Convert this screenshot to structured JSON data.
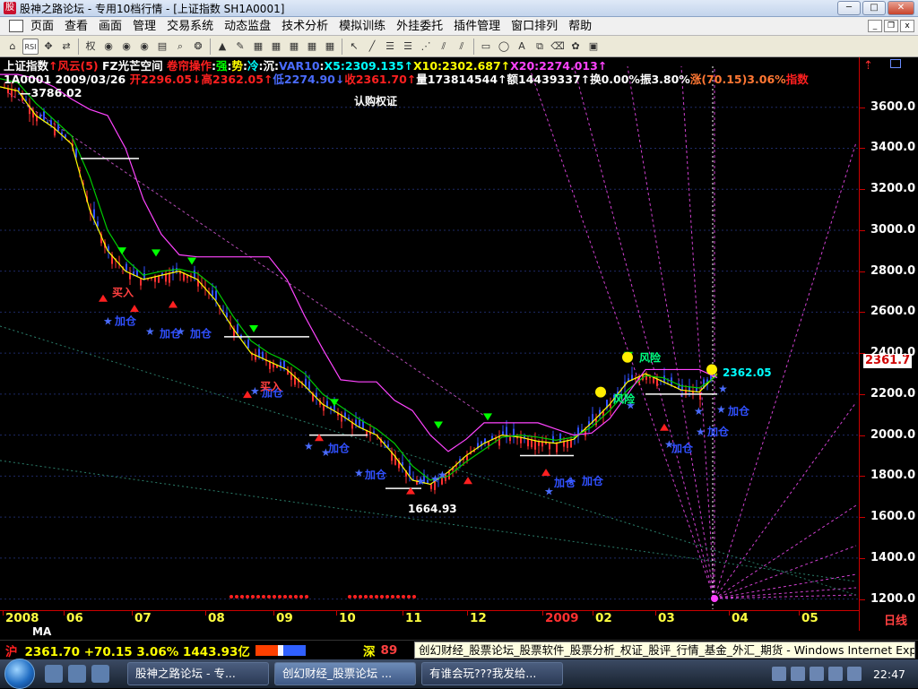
{
  "window": {
    "title": "股神之路论坛 - 专用10档行情 - [上证指数 SH1A0001]",
    "app_icon_glyph": "股",
    "buttons": [
      "minimize",
      "maximize",
      "close"
    ]
  },
  "menu": {
    "items": [
      "页面",
      "查看",
      "画面",
      "管理",
      "交易系统",
      "动态监盘",
      "技术分析",
      "模拟训练",
      "外挂委托",
      "插件管理",
      "窗口排列",
      "帮助"
    ]
  },
  "toolbar": {
    "icons": [
      "home-icon",
      "rsi-icon",
      "move-icon",
      "swap-icon",
      "weight-icon",
      "tool-icon",
      "tool-icon",
      "tool-icon",
      "book-icon",
      "search-icon",
      "indicator-icon",
      "alert-icon",
      "pen-icon",
      "grid-icon",
      "grid-icon",
      "grid-icon",
      "grid-icon",
      "grid-icon",
      "cursor-icon",
      "line-icon",
      "bars-icon",
      "bars-icon",
      "fan-icon",
      "fork-icon",
      "fork-icon",
      "rect-icon",
      "ellipse-icon",
      "text-icon",
      "copy-icon",
      "eraser-icon",
      "palette-icon",
      "save-icon"
    ],
    "labels": {
      "rsi": "RSI",
      "weight": "权"
    }
  },
  "header": {
    "line1": [
      {
        "text": "上证指数",
        "color": "w"
      },
      {
        "text": "↑风云(5) ",
        "color": "r"
      },
      {
        "text": "FZ光芒空间 ",
        "color": "w"
      },
      {
        "text": "卷帘操作",
        "color": "r"
      },
      {
        "text": ":",
        "color": "w"
      },
      {
        "text": "强",
        "color": "g"
      },
      {
        "text": ":",
        "color": "w"
      },
      {
        "text": "势",
        "color": "y"
      },
      {
        "text": ":",
        "color": "w"
      },
      {
        "text": "冷",
        "color": "c"
      },
      {
        "text": ":",
        "color": "w"
      },
      {
        "text": "沉",
        "color": "w"
      },
      {
        "text": ":",
        "color": "w"
      },
      {
        "text": "VAR10",
        "color": "b"
      },
      {
        "text": ":",
        "color": "w"
      },
      {
        "text": "X5:2309.135↑",
        "color": "c"
      },
      {
        "text": "X10:2302.687↑",
        "color": "y"
      },
      {
        "text": "X20:2274.013↑",
        "color": "m"
      }
    ],
    "line2": [
      {
        "text": "1A0001 2009/03/26 ",
        "color": "w"
      },
      {
        "text": "开2296.05↓",
        "color": "r"
      },
      {
        "text": "高2362.05↑",
        "color": "r"
      },
      {
        "text": "低2274.90↓",
        "color": "b"
      },
      {
        "text": "收2361.70↑",
        "color": "r"
      },
      {
        "text": "量173814544↑",
        "color": "w"
      },
      {
        "text": "额14439337↑",
        "color": "w"
      },
      {
        "text": "换0.00%",
        "color": "w"
      },
      {
        "text": "振3.80%",
        "color": "w"
      },
      {
        "text": "涨(70.15)3.06%",
        "color": "o"
      },
      {
        "text": "指数",
        "color": "r"
      }
    ]
  },
  "chart": {
    "high_label": "—3786.02",
    "low_label": "1664.93",
    "annotation": "认购权证",
    "price_tag": "2361.7",
    "price_tag_value": 2361.7,
    "last_label": "2362.05",
    "y_ticks": [
      "3600.0",
      "3400.0",
      "3200.0",
      "3000.0",
      "2800.0",
      "2600.0",
      "2400.0",
      "2200.0",
      "2000.0",
      "1800.0",
      "1600.0",
      "1400.0",
      "1200.0"
    ],
    "x_labels": [
      "2008",
      "06",
      "07",
      "08",
      "09",
      "10",
      "11",
      "12",
      "2009",
      "02",
      "03",
      "04",
      "05"
    ],
    "x_label_red_index": 8,
    "period_label": "日线",
    "bottom_indicator": "MA",
    "signals": {
      "buy": "买入",
      "add": "加仓",
      "risk": "风险"
    }
  },
  "chart_data": {
    "type": "candlestick",
    "title": "上证指数",
    "period": "日线",
    "y_range": [
      1150,
      3800
    ],
    "y_ticks": [
      3600,
      3400,
      3200,
      3000,
      2800,
      2600,
      2400,
      2200,
      2000,
      1800,
      1600,
      1400,
      1200
    ],
    "x_labels": [
      "2008",
      "06",
      "07",
      "08",
      "09",
      "10",
      "11",
      "12",
      "2009",
      "02",
      "03",
      "04",
      "05"
    ],
    "max_label": 3786.02,
    "min_label": 1664.93,
    "last": {
      "date": "2009/03/26",
      "open": 2296.05,
      "high": 2362.05,
      "low": 2274.9,
      "close": 2361.7,
      "volume": 173814544,
      "amount": 14439337,
      "change": 70.15,
      "change_pct": 3.06,
      "amplitude_pct": 3.8
    },
    "ma": {
      "X5": 2309.135,
      "X10": 2302.687,
      "X20": 2274.013
    },
    "series": [
      {
        "name": "X5",
        "color": "#ffff00",
        "points": [
          [
            0,
            3700
          ],
          [
            20,
            3680
          ],
          [
            40,
            3560
          ],
          [
            60,
            3500
          ],
          [
            80,
            3420
          ],
          [
            100,
            3100
          ],
          [
            120,
            2900
          ],
          [
            140,
            2800
          ],
          [
            160,
            2760
          ],
          [
            180,
            2780
          ],
          [
            200,
            2800
          ],
          [
            220,
            2760
          ],
          [
            240,
            2660
          ],
          [
            260,
            2520
          ],
          [
            280,
            2400
          ],
          [
            300,
            2360
          ],
          [
            320,
            2320
          ],
          [
            340,
            2240
          ],
          [
            360,
            2150
          ],
          [
            380,
            2100
          ],
          [
            400,
            2040
          ],
          [
            420,
            2000
          ],
          [
            440,
            1900
          ],
          [
            460,
            1780
          ],
          [
            480,
            1760
          ],
          [
            500,
            1820
          ],
          [
            520,
            1900
          ],
          [
            540,
            1960
          ],
          [
            560,
            2000
          ],
          [
            580,
            1990
          ],
          [
            600,
            1970
          ],
          [
            620,
            1960
          ],
          [
            640,
            1980
          ],
          [
            660,
            2060
          ],
          [
            680,
            2150
          ],
          [
            700,
            2260
          ],
          [
            720,
            2300
          ],
          [
            740,
            2260
          ],
          [
            760,
            2220
          ],
          [
            780,
            2210
          ],
          [
            800,
            2300
          ]
        ]
      },
      {
        "name": "X10",
        "color": "#00cc00",
        "points": [
          [
            0,
            3740
          ],
          [
            20,
            3720
          ],
          [
            40,
            3620
          ],
          [
            60,
            3540
          ],
          [
            80,
            3460
          ],
          [
            100,
            3260
          ],
          [
            120,
            3000
          ],
          [
            140,
            2860
          ],
          [
            160,
            2780
          ],
          [
            180,
            2800
          ],
          [
            200,
            2810
          ],
          [
            220,
            2790
          ],
          [
            240,
            2720
          ],
          [
            260,
            2580
          ],
          [
            280,
            2460
          ],
          [
            300,
            2400
          ],
          [
            320,
            2360
          ],
          [
            340,
            2300
          ],
          [
            360,
            2200
          ],
          [
            380,
            2140
          ],
          [
            400,
            2080
          ],
          [
            420,
            2030
          ],
          [
            440,
            1960
          ],
          [
            460,
            1850
          ],
          [
            480,
            1780
          ],
          [
            500,
            1800
          ],
          [
            520,
            1870
          ],
          [
            540,
            1930
          ],
          [
            560,
            1990
          ],
          [
            580,
            2000
          ],
          [
            600,
            1990
          ],
          [
            620,
            1975
          ],
          [
            640,
            1990
          ],
          [
            660,
            2040
          ],
          [
            680,
            2120
          ],
          [
            700,
            2220
          ],
          [
            720,
            2290
          ],
          [
            740,
            2280
          ],
          [
            760,
            2240
          ],
          [
            780,
            2230
          ],
          [
            800,
            2290
          ]
        ]
      },
      {
        "name": "X20",
        "color": "#ff44ff",
        "points": [
          [
            0,
            3760
          ],
          [
            20,
            3760
          ],
          [
            40,
            3740
          ],
          [
            60,
            3700
          ],
          [
            80,
            3640
          ],
          [
            100,
            3590
          ],
          [
            120,
            3560
          ],
          [
            140,
            3400
          ],
          [
            160,
            3150
          ],
          [
            180,
            2980
          ],
          [
            200,
            2880
          ],
          [
            220,
            2870
          ],
          [
            240,
            2870
          ],
          [
            260,
            2870
          ],
          [
            280,
            2870
          ],
          [
            300,
            2870
          ],
          [
            320,
            2760
          ],
          [
            340,
            2580
          ],
          [
            360,
            2420
          ],
          [
            380,
            2270
          ],
          [
            400,
            2260
          ],
          [
            420,
            2260
          ],
          [
            440,
            2170
          ],
          [
            460,
            2120
          ],
          [
            480,
            2000
          ],
          [
            500,
            1920
          ],
          [
            520,
            1980
          ],
          [
            540,
            2060
          ],
          [
            560,
            2060
          ],
          [
            580,
            2060
          ],
          [
            600,
            2060
          ],
          [
            620,
            2030
          ],
          [
            640,
            2000
          ],
          [
            660,
            2010
          ],
          [
            680,
            2080
          ],
          [
            700,
            2200
          ],
          [
            720,
            2320
          ],
          [
            740,
            2320
          ],
          [
            760,
            2320
          ],
          [
            780,
            2320
          ],
          [
            800,
            2280
          ]
        ]
      }
    ],
    "annotations": [
      {
        "text": "认购权证",
        "x": 420,
        "y": 3540
      },
      {
        "text": "1664.93",
        "x": 483,
        "y": 1664.93
      }
    ]
  },
  "status": {
    "sh_label": "沪",
    "sh_value": "2361.70 +70.15 3.06% 1443.93亿",
    "sz_label": "深",
    "sz_value": "89"
  },
  "tooltip": {
    "text": "创幻财经_股票论坛_股票软件_股票分析_权证_股评_行情_基金_外汇_期货 - Windows Internet Explorer"
  },
  "taskbar": {
    "tasks": [
      "股神之路论坛 - 专...",
      "创幻财经_股票论坛 ...",
      "有谁会玩???我发给..."
    ],
    "active_index": 1,
    "clock": "22:47"
  }
}
